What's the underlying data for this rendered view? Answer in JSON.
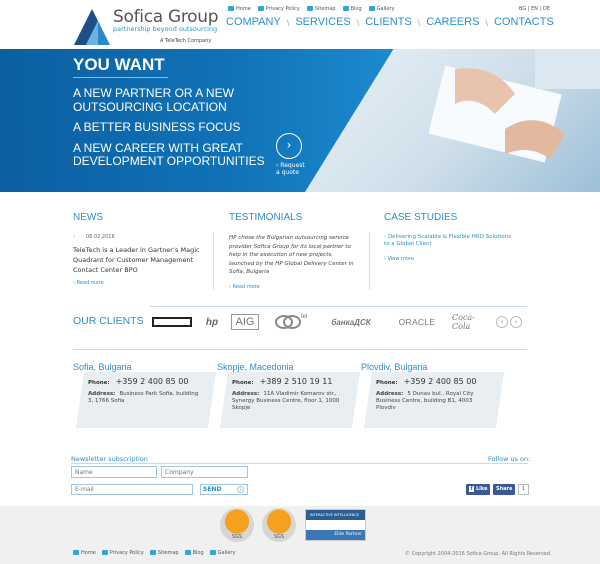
{
  "header": {
    "brand": "Sofica Group",
    "tagline": "partnership beyond outsourcing",
    "parent": "A TeleTech Company",
    "top_links": [
      "Home",
      "Privacy Policy",
      "Sitemap",
      "Blog",
      "Gallery"
    ],
    "languages": "BG | EN | DE",
    "main_nav": [
      "COMPANY",
      "SERVICES",
      "CLIENTS",
      "CAREERS",
      "CONTACTS"
    ]
  },
  "hero": {
    "heading": "YOU WANT",
    "lines": [
      "A NEW PARTNER OR A NEW",
      "OUTSOURCING LOCATION",
      "A BETTER BUSINESS FOCUS",
      "A NEW CAREER WITH GREAT",
      "DEVELOPMENT OPPORTUNITIES"
    ],
    "cta_arrow": "›",
    "cta_label_1": "› Request",
    "cta_label_2": "a quote"
  },
  "news": {
    "title": "NEWS",
    "date": "08.02.2016",
    "date_prefix": "›",
    "body": "TeleTech is a Leader in Gartner’s Magic Quadrant for Customer Management Contact Center BPO",
    "read_more": "› Read more"
  },
  "testimonials": {
    "title": "TESTIMONIALS",
    "body": "HP chose the Bulgarian outsourcing service provider Sofica Group for its local partner to help in the execution of new projects, launched by the HP Global Delivery Center in Sofia, Bulgaria",
    "read_more": "› Read more"
  },
  "case_studies": {
    "title": "CASE STUDIES",
    "link": "› Delivering Scalable & Flexible HRO Solutions to a Global Client",
    "view_more": "› View more"
  },
  "clients": {
    "title": "OUR CLIENTS",
    "logos": [
      "",
      "hp",
      "AIG",
      "tel",
      "банкаДСК",
      "ORACLE",
      "Coca-Cola"
    ],
    "prev": "‹",
    "next": "›"
  },
  "offices": [
    {
      "city": "Sofia, Bulgaria",
      "phone_label": "Phone:",
      "phone": "+359 2 400 85 00",
      "address_label": "Address:",
      "address": "Business Park Sofia, building 3, 1766 Sofia"
    },
    {
      "city": "Skopje, Macedonia",
      "phone_label": "Phone:",
      "phone": "+389 2 510 19 11",
      "address_label": "Address:",
      "address": "11A Vladimir Komarov str., Synergy Business Centre, floor 1, 1000 Skopje"
    },
    {
      "city": "Plovdiv, Bulgaria",
      "phone_label": "Phone:",
      "phone": "+359 2 400 85 00",
      "address_label": "Address:",
      "address": "5 Dunav bul., Royal City Business Centre, building B1, 4003 Plovdiv"
    }
  ],
  "newsletter": {
    "title": "Newsletter subscription",
    "name_placeholder": "Name",
    "company_placeholder": "Company",
    "email_placeholder": "E-mail",
    "send_label": "SEND",
    "send_arrow": "›"
  },
  "social": {
    "follow": "Follow us on:",
    "like": "Like",
    "share": "Share",
    "count": "1"
  },
  "footer": {
    "badges": [
      "SGS",
      "SGS"
    ],
    "partner_top": "INTERACTIVE INTELLIGENCE",
    "partner_bottom": "Elite Partner",
    "links": [
      "Home",
      "Privacy Policy",
      "Sitemap",
      "Blog",
      "Gallery"
    ],
    "copyright": "© Copyright 2004-2016 Sofica Group. All Rights Reserved."
  }
}
